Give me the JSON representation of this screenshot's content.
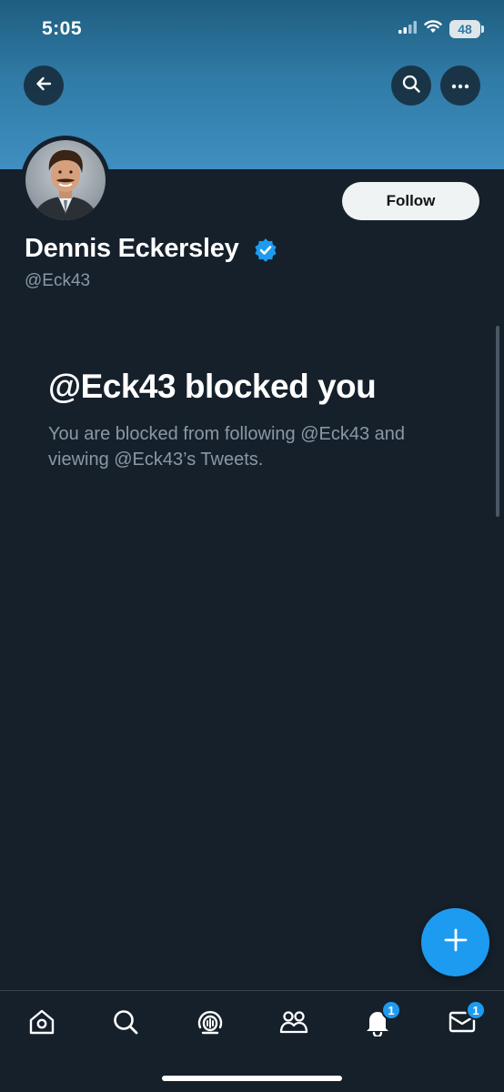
{
  "status_bar": {
    "time": "5:05",
    "battery": "48",
    "icons": [
      "cellular-signal-icon",
      "wifi-icon",
      "battery-icon"
    ]
  },
  "header": {
    "back_icon": "back-arrow-icon",
    "search_icon": "search-icon",
    "more_icon": "more-options-icon"
  },
  "profile": {
    "display_name": "Dennis Eckersley",
    "handle": "@Eck43",
    "verified": true,
    "follow_label": "Follow"
  },
  "blocked": {
    "title": "@Eck43 blocked you",
    "message": "You are blocked from following @Eck43 and viewing @Eck43’s Tweets."
  },
  "tab_bar": {
    "items": [
      {
        "name": "home",
        "icon": "home-icon"
      },
      {
        "name": "search",
        "icon": "search-icon"
      },
      {
        "name": "spaces",
        "icon": "spaces-icon"
      },
      {
        "name": "communities",
        "icon": "communities-icon"
      },
      {
        "name": "notifications",
        "icon": "bell-icon",
        "badge": "1"
      },
      {
        "name": "messages",
        "icon": "envelope-icon",
        "badge": "1"
      }
    ]
  },
  "colors": {
    "background": "#15202b",
    "accent": "#1d9bf0",
    "secondary_text": "#8b98a5",
    "banner": "#2f7aa6"
  }
}
